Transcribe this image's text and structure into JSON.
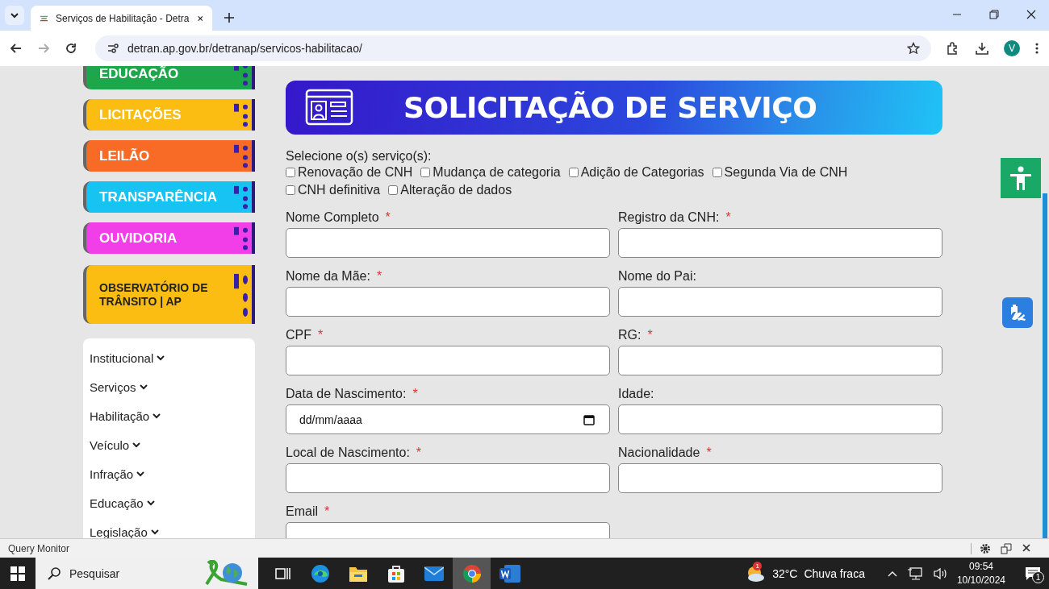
{
  "browser": {
    "tabs": [
      {
        "title": "Serviços de Habilitação - Detra",
        "selected": true
      }
    ],
    "url": "detran.ap.gov.br/detranap/servicos-habilitacao/",
    "profile_initial": "V"
  },
  "sidebar": {
    "cards": [
      {
        "label": "EDUCAÇÃO",
        "color": "#1ea64a",
        "kind": "short"
      },
      {
        "label": "LICITAÇÕES",
        "color": "#fbbd12",
        "kind": "short"
      },
      {
        "label": "LEILÃO",
        "color": "#f76b27",
        "kind": "short"
      },
      {
        "label": "TRANSPARÊNCIA",
        "color": "#16c3f2",
        "kind": "short"
      },
      {
        "label": "OUVIDORIA",
        "color": "#f23ee8",
        "kind": "short"
      },
      {
        "label": "OBSERVATÓRIO DE TRÂNSITO | AP",
        "color": "#fbbd12",
        "kind": "tall"
      }
    ],
    "menu": [
      {
        "label": "Institucional"
      },
      {
        "label": "Serviços"
      },
      {
        "label": "Habilitação"
      },
      {
        "label": "Veículo"
      },
      {
        "label": "Infração"
      },
      {
        "label": "Educação"
      },
      {
        "label": "Legislação"
      }
    ]
  },
  "form": {
    "banner_title": "SOLICITAÇÃO DE SERVIÇO",
    "services_label": "Selecione o(s) serviço(s):",
    "services": [
      {
        "label": "Renovação de CNH",
        "checked": false
      },
      {
        "label": "Mudança de categoria",
        "checked": false
      },
      {
        "label": "Adição de Categorias",
        "checked": false
      },
      {
        "label": "Segunda Via de CNH",
        "checked": false
      },
      {
        "label": "CNH definitiva",
        "checked": false
      },
      {
        "label": "Alteração de dados",
        "checked": false
      }
    ],
    "fields": [
      {
        "label": "Nome Completo",
        "required_mark": "*",
        "kind": "text"
      },
      {
        "label": "Registro da CNH:",
        "required_mark": "*",
        "kind": "text"
      },
      {
        "label": "Nome da Mãe:",
        "required_mark": "*",
        "kind": "text"
      },
      {
        "label": "Nome do Pai:",
        "kind": "text"
      },
      {
        "label": "CPF",
        "required_mark": "*",
        "kind": "text"
      },
      {
        "label": "RG:",
        "required_mark": "*",
        "kind": "text"
      },
      {
        "label": "Data de Nascimento:",
        "required_mark": "*",
        "kind": "date",
        "placeholder": "dd/mm/aaaa"
      },
      {
        "label": "Idade:",
        "kind": "text"
      },
      {
        "label": "Local de Nascimento:",
        "required_mark": "*",
        "kind": "text"
      },
      {
        "label": "Nacionalidade",
        "required_mark": "*",
        "kind": "text"
      },
      {
        "label": "Email",
        "required_mark": "*",
        "kind": "text"
      }
    ]
  },
  "devtools_bar": {
    "title": "Query Monitor"
  },
  "taskbar": {
    "search_placeholder": "Pesquisar",
    "apps": [
      {
        "kind": "taskview",
        "selected": false
      },
      {
        "kind": "edge",
        "selected": false
      },
      {
        "kind": "explorer",
        "selected": false
      },
      {
        "kind": "store",
        "selected": false
      },
      {
        "kind": "mail",
        "selected": false
      },
      {
        "kind": "chrome",
        "selected": true
      },
      {
        "kind": "word",
        "selected": false
      }
    ],
    "weather_badge": "1",
    "temperature": "32°C",
    "weather": "Chuva fraca",
    "time": "09:54",
    "date": "10/10/2024",
    "notification_count": "1"
  }
}
